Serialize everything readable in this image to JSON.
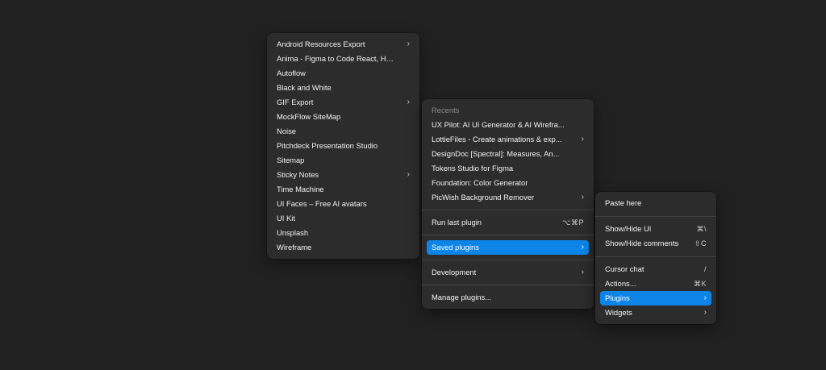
{
  "plugins_menu": {
    "items": [
      {
        "label": "Android Resources Export",
        "submenu": true
      },
      {
        "label": "Anima - Figma to Code React, HTML...",
        "submenu": false
      },
      {
        "label": "Autoflow",
        "submenu": false
      },
      {
        "label": "Black and White",
        "submenu": false
      },
      {
        "label": "GIF Export",
        "submenu": true
      },
      {
        "label": "MockFlow SiteMap",
        "submenu": false
      },
      {
        "label": "Noise",
        "submenu": false
      },
      {
        "label": "Pitchdeck Presentation Studio",
        "submenu": false
      },
      {
        "label": "Sitemap",
        "submenu": false
      },
      {
        "label": "Sticky Notes",
        "submenu": true
      },
      {
        "label": "Time Machine",
        "submenu": false
      },
      {
        "label": "UI Faces – Free AI avatars",
        "submenu": false
      },
      {
        "label": "UI Kit",
        "submenu": false
      },
      {
        "label": "Unsplash",
        "submenu": false
      },
      {
        "label": "Wireframe",
        "submenu": false
      }
    ]
  },
  "saved_menu": {
    "recents_label": "Recents",
    "recents": [
      {
        "label": "UX Pilot: AI UI Generator & AI Wirefra...",
        "submenu": false
      },
      {
        "label": "LottieFiles - Create animations & exp...",
        "submenu": true
      },
      {
        "label": "DesignDoc [Spectral]: Measures, An...",
        "submenu": false
      },
      {
        "label": "Tokens Studio for Figma",
        "submenu": false
      },
      {
        "label": "Foundation: Color Generator",
        "submenu": false
      },
      {
        "label": "PicWish Background Remover",
        "submenu": true
      }
    ],
    "run_last_plugin": {
      "label": "Run last plugin",
      "shortcut": "⌥⌘P"
    },
    "saved_plugins": {
      "label": "Saved plugins"
    },
    "development": {
      "label": "Development"
    },
    "manage_plugins": {
      "label": "Manage plugins..."
    }
  },
  "main_menu": {
    "paste_here": {
      "label": "Paste here"
    },
    "show_hide_ui": {
      "label": "Show/Hide UI",
      "shortcut": "⌘\\"
    },
    "show_hide_comments": {
      "label": "Show/Hide comments",
      "shortcut": "⇧C"
    },
    "cursor_chat": {
      "label": "Cursor chat",
      "shortcut": "/"
    },
    "actions": {
      "label": "Actions...",
      "shortcut": "⌘K"
    },
    "plugins": {
      "label": "Plugins"
    },
    "widgets": {
      "label": "Widgets"
    }
  },
  "chevron_glyph": "›",
  "colors": {
    "background": "#212121",
    "menu_background": "#2c2c2c",
    "highlight": "#0d85e8",
    "muted_text": "#8a8a8a"
  }
}
